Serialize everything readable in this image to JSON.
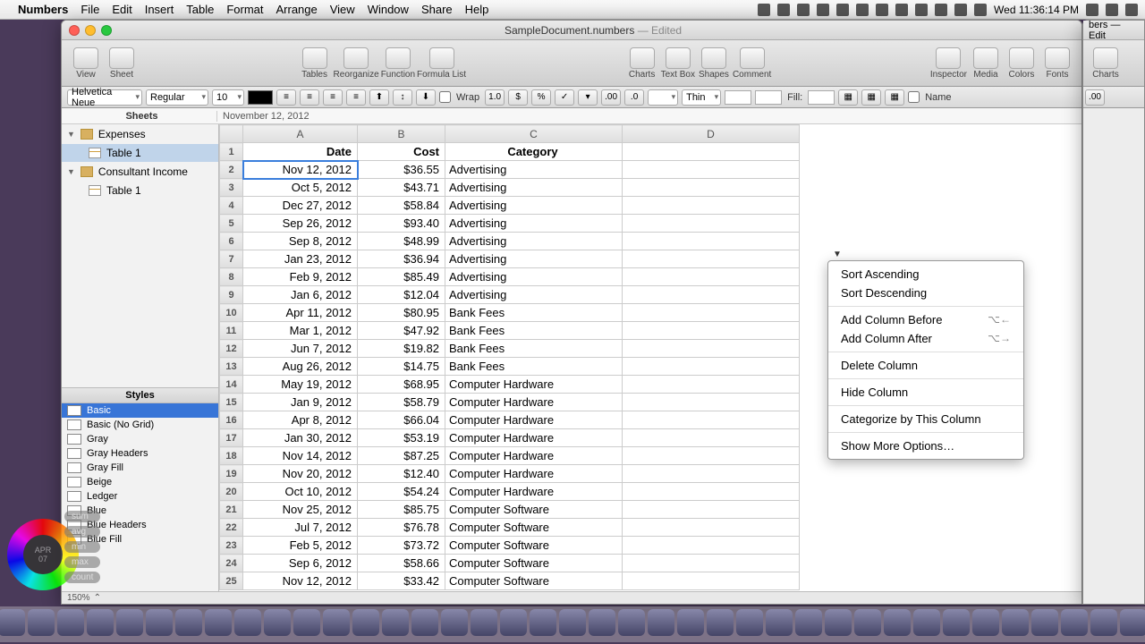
{
  "menubar": {
    "app": "Numbers",
    "items": [
      "File",
      "Edit",
      "Insert",
      "Table",
      "Format",
      "Arrange",
      "View",
      "Window",
      "Share",
      "Help"
    ],
    "clock": "Wed 11:36:14 PM"
  },
  "window": {
    "title": "SampleDocument.numbers",
    "edited": "— Edited"
  },
  "toolbar": {
    "left": [
      {
        "label": "View"
      },
      {
        "label": "Sheet"
      }
    ],
    "mid": [
      {
        "label": "Tables"
      },
      {
        "label": "Reorganize"
      },
      {
        "label": "Function"
      },
      {
        "label": "Formula List"
      }
    ],
    "mid2": [
      {
        "label": "Charts"
      },
      {
        "label": "Text Box"
      },
      {
        "label": "Shapes"
      },
      {
        "label": "Comment"
      }
    ],
    "right": [
      {
        "label": "Inspector"
      },
      {
        "label": "Media"
      },
      {
        "label": "Colors"
      },
      {
        "label": "Fonts"
      }
    ]
  },
  "formatbar": {
    "font": "Helvetica Neue",
    "weight": "Regular",
    "size": "10",
    "wrap": "Wrap",
    "border": "Thin",
    "fill": "Fill:",
    "namecb": "Name"
  },
  "panels": {
    "sheets_header": "Sheets",
    "styles_header": "Styles"
  },
  "sheets": [
    {
      "name": "Expenses",
      "tables": [
        "Table 1"
      ],
      "selected": true
    },
    {
      "name": "Consultant Income",
      "tables": [
        "Table 1"
      ]
    }
  ],
  "styles": [
    "Basic",
    "Basic (No Grid)",
    "Gray",
    "Gray Headers",
    "Gray Fill",
    "Beige",
    "Ledger",
    "Blue",
    "Blue Headers",
    "Blue Fill"
  ],
  "cellref": "November 12, 2012",
  "columns": [
    "A",
    "B",
    "C",
    "D"
  ],
  "headers": {
    "a": "Date",
    "b": "Cost",
    "c": "Category"
  },
  "rows": [
    {
      "n": 2,
      "date": "Nov 12, 2012",
      "cost": "$36.55",
      "cat": "Advertising",
      "sel": true
    },
    {
      "n": 3,
      "date": "Oct 5, 2012",
      "cost": "$43.71",
      "cat": "Advertising"
    },
    {
      "n": 4,
      "date": "Dec 27, 2012",
      "cost": "$58.84",
      "cat": "Advertising"
    },
    {
      "n": 5,
      "date": "Sep 26, 2012",
      "cost": "$93.40",
      "cat": "Advertising"
    },
    {
      "n": 6,
      "date": "Sep 8, 2012",
      "cost": "$48.99",
      "cat": "Advertising"
    },
    {
      "n": 7,
      "date": "Jan 23, 2012",
      "cost": "$36.94",
      "cat": "Advertising"
    },
    {
      "n": 8,
      "date": "Feb 9, 2012",
      "cost": "$85.49",
      "cat": "Advertising"
    },
    {
      "n": 9,
      "date": "Jan 6, 2012",
      "cost": "$12.04",
      "cat": "Advertising"
    },
    {
      "n": 10,
      "date": "Apr 11, 2012",
      "cost": "$80.95",
      "cat": "Bank Fees"
    },
    {
      "n": 11,
      "date": "Mar 1, 2012",
      "cost": "$47.92",
      "cat": "Bank Fees"
    },
    {
      "n": 12,
      "date": "Jun 7, 2012",
      "cost": "$19.82",
      "cat": "Bank Fees"
    },
    {
      "n": 13,
      "date": "Aug 26, 2012",
      "cost": "$14.75",
      "cat": "Bank Fees"
    },
    {
      "n": 14,
      "date": "May 19, 2012",
      "cost": "$68.95",
      "cat": "Computer Hardware"
    },
    {
      "n": 15,
      "date": "Jan 9, 2012",
      "cost": "$58.79",
      "cat": "Computer Hardware"
    },
    {
      "n": 16,
      "date": "Apr 8, 2012",
      "cost": "$66.04",
      "cat": "Computer Hardware"
    },
    {
      "n": 17,
      "date": "Jan 30, 2012",
      "cost": "$53.19",
      "cat": "Computer Hardware"
    },
    {
      "n": 18,
      "date": "Nov 14, 2012",
      "cost": "$87.25",
      "cat": "Computer Hardware"
    },
    {
      "n": 19,
      "date": "Nov 20, 2012",
      "cost": "$12.40",
      "cat": "Computer Hardware"
    },
    {
      "n": 20,
      "date": "Oct 10, 2012",
      "cost": "$54.24",
      "cat": "Computer Hardware"
    },
    {
      "n": 21,
      "date": "Nov 25, 2012",
      "cost": "$85.75",
      "cat": "Computer Software"
    },
    {
      "n": 22,
      "date": "Jul 7, 2012",
      "cost": "$76.78",
      "cat": "Computer Software"
    },
    {
      "n": 23,
      "date": "Feb 5, 2012",
      "cost": "$73.72",
      "cat": "Computer Software"
    },
    {
      "n": 24,
      "date": "Sep 6, 2012",
      "cost": "$58.66",
      "cat": "Computer Software"
    },
    {
      "n": 25,
      "date": "Nov 12, 2012",
      "cost": "$33.42",
      "cat": "Computer Software"
    }
  ],
  "contextmenu": [
    {
      "label": "Sort Ascending"
    },
    {
      "label": "Sort Descending"
    },
    {
      "sep": true
    },
    {
      "label": "Add Column Before",
      "shortcut": "⌥←"
    },
    {
      "label": "Add Column After",
      "shortcut": "⌥→"
    },
    {
      "sep": true
    },
    {
      "label": "Delete Column"
    },
    {
      "sep": true
    },
    {
      "label": "Hide Column"
    },
    {
      "sep": true
    },
    {
      "label": "Categorize by This Column"
    },
    {
      "sep": true
    },
    {
      "label": "Show More Options…"
    }
  ],
  "zoom": "150%",
  "window2": {
    "title": "bers — Edit",
    "btn": "Charts",
    "decimal": ".00"
  },
  "sidebuttons": [
    "sum",
    "avg",
    "min",
    "max",
    "count"
  ]
}
